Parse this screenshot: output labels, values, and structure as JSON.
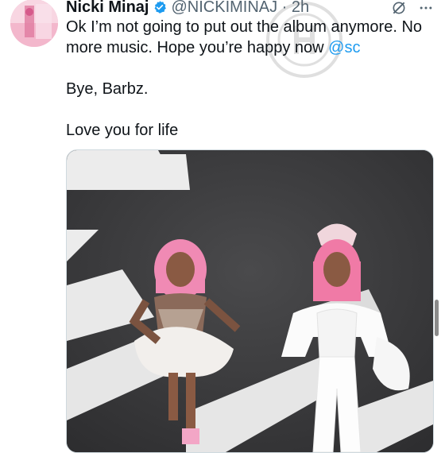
{
  "tweet": {
    "author_name": "Nicki Minaj",
    "handle_time": "@NICKIMINAJ · 2h",
    "line1": "Ok I’m not going to put out the album anymore. No more music. Hope you’re happy now ",
    "mention": "@sc",
    "line2": "Bye, Barbz.",
    "line3": "Love you for life"
  },
  "icons": {
    "verified": "verified-badge-icon",
    "grok": "grok-icon",
    "more": "more-icon"
  },
  "colors": {
    "text": "#0f1419",
    "secondary": "#536471",
    "accent": "#1d9bf0"
  }
}
